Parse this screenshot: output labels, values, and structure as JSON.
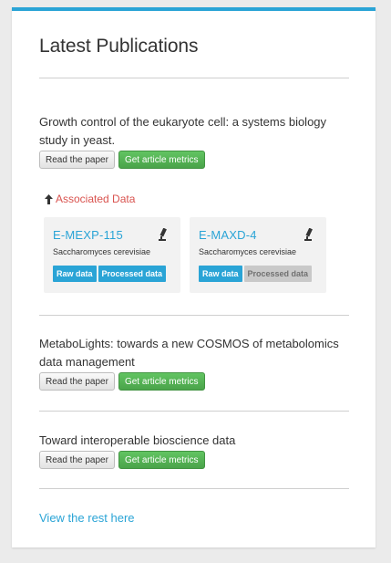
{
  "panel": {
    "title": "Latest Publications",
    "accent": "#2aa4d6"
  },
  "publications": [
    {
      "title": "Growth control of the eukaryote cell: a systems biology study in yeast.",
      "read_label": "Read the paper",
      "metrics_label": "Get article metrics"
    },
    {
      "title": "MetaboLights: towards a new COSMOS of metabolomics data management",
      "read_label": "Read the paper",
      "metrics_label": "Get article metrics"
    },
    {
      "title": "Toward interoperable bioscience data",
      "read_label": "Read the paper",
      "metrics_label": "Get article metrics"
    }
  ],
  "associated": {
    "label": "Associated Data",
    "icon": "arrow-up-icon",
    "datasets": [
      {
        "accession": "E-MEXP-115",
        "species": "Saccharomyces cerevisiae",
        "icon": "microscope-icon",
        "raw_label": "Raw data",
        "processed_label": "Processed data",
        "processed_available": true
      },
      {
        "accession": "E-MAXD-4",
        "species": "Saccharomyces cerevisiae",
        "icon": "microscope-icon",
        "raw_label": "Raw data",
        "processed_label": "Processed data",
        "processed_available": false
      }
    ]
  },
  "footer": {
    "view_rest": "View the rest here"
  }
}
